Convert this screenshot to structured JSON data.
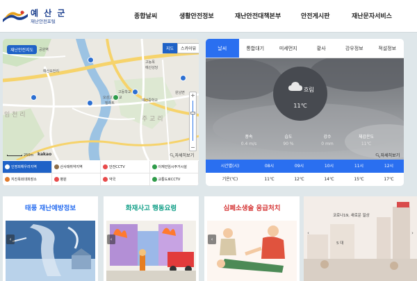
{
  "header": {
    "logo_title": "예 산 군",
    "logo_sub": "재난안전포털",
    "nav": [
      "종합날씨",
      "생활안전정보",
      "재난안전대책본부",
      "안전게시판",
      "재난문자서비스"
    ]
  },
  "map": {
    "badge": "재난안전지도",
    "type_options": [
      "지도",
      "스카이뷰"
    ],
    "scale": "250m",
    "provider": "kakao",
    "more": "자세히보기",
    "labels": {
      "l1": "공원역",
      "l2": "예산요전리",
      "l3": "고농목",
      "l4": "예산성당",
      "l5": "고등학교",
      "l6": "오성고등학교",
      "l7": "빌라트",
      "l8": "예산중학교",
      "l9": "원남면",
      "l10": "주 교 리",
      "l11": "임 천 리"
    },
    "legend": [
      {
        "label": "인명피해우려지역",
        "color": "#1f62c7"
      },
      {
        "label": "산사태취약지역",
        "color": "#8d6e4a"
      },
      {
        "label": "안전CCTV",
        "color": "#e84b4b"
      },
      {
        "label": "이재민임시주거시설",
        "color": "#2f9b4a"
      },
      {
        "label": "지진옥외대피장소",
        "color": "#e07a2b"
      },
      {
        "label": "병원",
        "color": "#e84b4b"
      },
      {
        "label": "약국",
        "color": "#e84b4b"
      },
      {
        "label": "교통도로CCTV",
        "color": "#2f9b4a"
      }
    ]
  },
  "weather": {
    "tabs": [
      "날씨",
      "통합대기",
      "미세먼지",
      "황사",
      "강우정보",
      "적설정보"
    ],
    "condition": "흐림",
    "temperature": "11℃",
    "stats": [
      {
        "key": "풍속",
        "value": "0.4 m/s"
      },
      {
        "key": "습도",
        "value": "90 %"
      },
      {
        "key": "강수",
        "value": "0 mm"
      },
      {
        "key": "체감온도",
        "value": "11℃"
      }
    ],
    "more": "자세히보기",
    "hourly": {
      "time_label": "시간별(시)",
      "temp_label": "기온(℃)",
      "times": [
        "08시",
        "09시",
        "10시",
        "11시",
        "12시"
      ],
      "temps": [
        "11℃",
        "12℃",
        "14℃",
        "15℃",
        "17℃"
      ]
    }
  },
  "cards": [
    {
      "title": "태풍 재난예방정보",
      "color": "#2a6ff0"
    },
    {
      "title": "화재사고 행동요령",
      "color": "#16a18a"
    },
    {
      "title": "심폐소생술 응급처치",
      "color": "#d63a3a"
    }
  ],
  "banner": {
    "text": "코로나19, 새로운 일상",
    "num": "5 대"
  }
}
